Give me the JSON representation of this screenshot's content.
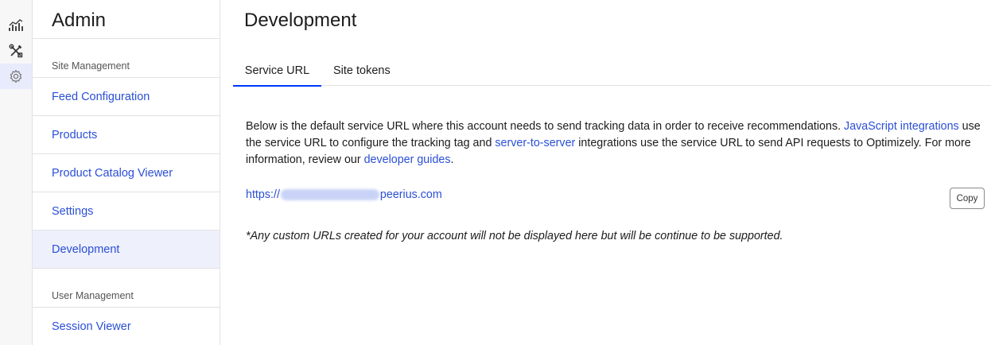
{
  "rail": {
    "items": [
      {
        "icon": "analytics-icon"
      },
      {
        "icon": "tools-icon"
      },
      {
        "icon": "gear-icon",
        "active": true
      }
    ]
  },
  "sidebar": {
    "title": "Admin",
    "sections": [
      {
        "label": "Site Management"
      },
      {
        "label": "User Management"
      }
    ],
    "items": [
      {
        "label": "Feed Configuration"
      },
      {
        "label": "Products"
      },
      {
        "label": "Product Catalog Viewer"
      },
      {
        "label": "Settings"
      },
      {
        "label": "Development",
        "active": true
      },
      {
        "label": "Session Viewer"
      }
    ]
  },
  "main": {
    "title": "Development",
    "tabs": [
      {
        "label": "Service URL",
        "active": true
      },
      {
        "label": "Site tokens"
      }
    ],
    "description": {
      "part1": "Below is the default service URL where this account needs to send tracking data in order to receive recommendations. ",
      "link1": "JavaScript integrations",
      "part2": " use the service URL to configure the tracking tag and ",
      "link2": "server-to-server",
      "part3": " integrations use the service URL to send API requests to Optimizely. For more information, review our ",
      "link3": "developer guides",
      "part4": "."
    },
    "service_url": {
      "prefix": "https://",
      "suffix": "peerius.com"
    },
    "copy_label": "Copy",
    "note": "*Any custom URLs created for your account will not be displayed here but will be continue to be supported."
  },
  "colors": {
    "accent": "#0037ff",
    "link": "#2a4fd6",
    "active_bg": "#eef0fc"
  }
}
